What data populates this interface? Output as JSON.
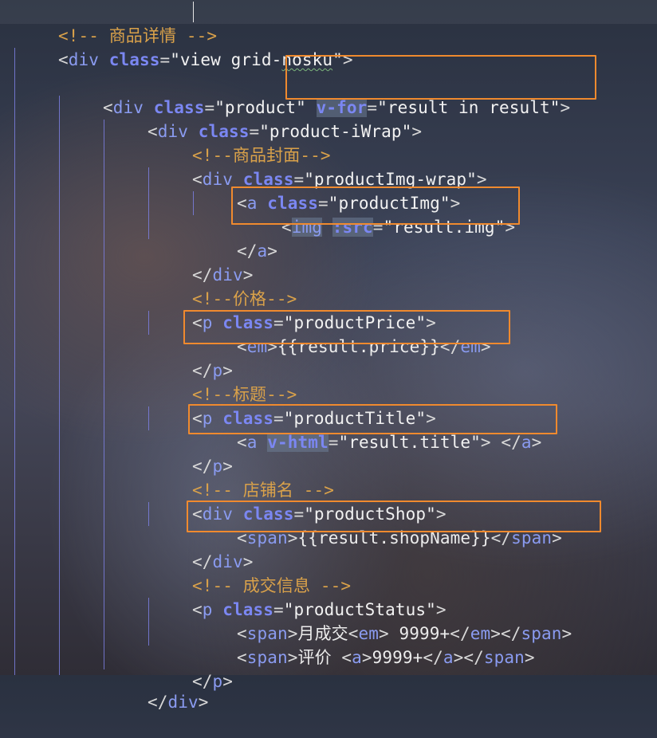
{
  "editor": {
    "lines": [
      [
        "<!-- 商品详情 -->"
      ],
      [
        "<",
        "div",
        " ",
        "class",
        "=",
        "\"view grid-",
        "nosku",
        "\"",
        ">"
      ],
      [
        ""
      ],
      [
        "<",
        "div",
        " ",
        "class",
        "=",
        "\"product\"",
        " ",
        "v-for",
        "=",
        "\"result in result\"",
        ">"
      ],
      [
        "<",
        "div",
        " ",
        "class",
        "=",
        "\"product-iWrap\"",
        ">"
      ],
      [
        "<!--商品封面-->"
      ],
      [
        "<",
        "div",
        " ",
        "class",
        "=",
        "\"productImg-wrap\"",
        ">"
      ],
      [
        "<",
        "a",
        " ",
        "class",
        "=",
        "\"productImg\"",
        ">"
      ],
      [
        "<",
        "img",
        " ",
        ":src",
        "=",
        "\"result.img\"",
        ">"
      ],
      [
        "</",
        "a",
        ">"
      ],
      [
        "</",
        "div",
        ">"
      ],
      [
        "<!--价格-->"
      ],
      [
        "<",
        "p",
        " ",
        "class",
        "=",
        "\"productPrice\"",
        ">"
      ],
      [
        "<",
        "em",
        ">",
        "{{result.price}}",
        "</",
        "em",
        ">"
      ],
      [
        "</",
        "p",
        ">"
      ],
      [
        "<!--标题-->"
      ],
      [
        "<",
        "p",
        " ",
        "class",
        "=",
        "\"productTitle\"",
        ">"
      ],
      [
        "<",
        "a",
        " ",
        "v-html",
        "=",
        "\"result.title\"",
        "> ",
        "</",
        "a",
        ">"
      ],
      [
        "</",
        "p",
        ">"
      ],
      [
        "<!-- 店铺名 -->"
      ],
      [
        "<",
        "div",
        " ",
        "class",
        "=",
        "\"productShop\"",
        ">"
      ],
      [
        "<",
        "span",
        ">",
        "{{result.shopName}}",
        "</",
        "span",
        ">"
      ],
      [
        "</",
        "div",
        ">"
      ],
      [
        "<!-- 成交信息 -->"
      ],
      [
        "<",
        "p",
        " ",
        "class",
        "=",
        "\"productStatus\"",
        ">"
      ],
      [
        "<",
        "span",
        ">",
        "月成交",
        "<",
        "em",
        ">",
        " 9999+",
        "</",
        "em",
        ">",
        "</",
        "span",
        ">"
      ],
      [
        "<",
        "span",
        ">",
        "评价 ",
        "<",
        "a",
        ">",
        "9999+",
        "</",
        "a",
        ">",
        "</",
        "span",
        ">"
      ],
      [
        "</",
        "p",
        ">"
      ],
      [
        "</",
        "div",
        ">"
      ]
    ]
  }
}
